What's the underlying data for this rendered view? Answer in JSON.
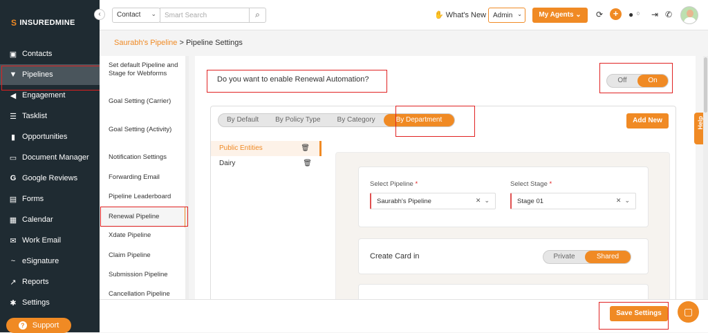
{
  "brand": {
    "name": "INSUREDMINE",
    "collapse_glyph": "‹",
    "accent": "#f08a24",
    "sidebar_bg": "#1f2b32",
    "highlight": "#e02020"
  },
  "sidebar": {
    "items": [
      {
        "label": "Contacts",
        "icon": "contact-card-icon"
      },
      {
        "label": "Pipelines",
        "icon": "funnel-icon"
      },
      {
        "label": "Engagement",
        "icon": "megaphone-icon"
      },
      {
        "label": "Tasklist",
        "icon": "tasklist-icon"
      },
      {
        "label": "Opportunities",
        "icon": "bar-chart-icon"
      },
      {
        "label": "Document Manager",
        "icon": "folder-icon"
      },
      {
        "label": "Google Reviews",
        "icon": "google-icon"
      },
      {
        "label": "Forms",
        "icon": "form-icon"
      },
      {
        "label": "Calendar",
        "icon": "calendar-icon"
      },
      {
        "label": "Work Email",
        "icon": "mail-icon"
      },
      {
        "label": "eSignature",
        "icon": "signature-icon"
      },
      {
        "label": "Reports",
        "icon": "reports-icon"
      },
      {
        "label": "Settings",
        "icon": "gear-icon"
      }
    ],
    "active": "Pipelines",
    "support_label": "Support"
  },
  "topbar": {
    "context_value": "Contact",
    "search_placeholder": "Smart Search",
    "whats_new": "What's New",
    "admin_label": "Admin",
    "my_agents_label": "My Agents",
    "notification_count": "0"
  },
  "breadcrumb": {
    "link": "Saurabh's Pipeline",
    "separator": " > ",
    "current": "Pipeline Settings"
  },
  "settings_nav": [
    "Set default Pipeline and Stage for Webforms",
    "Goal Setting (Carrier)",
    "Goal Setting (Activity)",
    "Notification Settings",
    "Forwarding Email",
    "Pipeline Leaderboard",
    "Renewal Pipeline",
    "Xdate Pipeline",
    "Claim Pipeline",
    "Submission Pipeline",
    "Cancellation Pipeline"
  ],
  "settings_nav_active": "Renewal Pipeline",
  "renewal": {
    "question": "Do you want to enable Renewal Automation?",
    "toggle_off": "Off",
    "toggle_on": "On",
    "toggle_state": "On"
  },
  "tabs": {
    "items": [
      "By Default",
      "By Policy Type",
      "By Category",
      "By Department"
    ],
    "active": "By Department",
    "add_new": "Add New"
  },
  "departments": [
    {
      "name": "Public Entities",
      "active": true
    },
    {
      "name": "Dairy",
      "active": false
    }
  ],
  "form": {
    "pipeline_label": "Select Pipeline",
    "pipeline_value": "Saurabh's Pipeline",
    "stage_label": "Select Stage",
    "stage_value": "Stage 01",
    "required_mark": "*",
    "create_card_label": "Create Card in",
    "create_private": "Private",
    "create_shared": "Shared",
    "create_state": "Shared"
  },
  "footer": {
    "save_label": "Save Settings",
    "help_label": "Help"
  }
}
